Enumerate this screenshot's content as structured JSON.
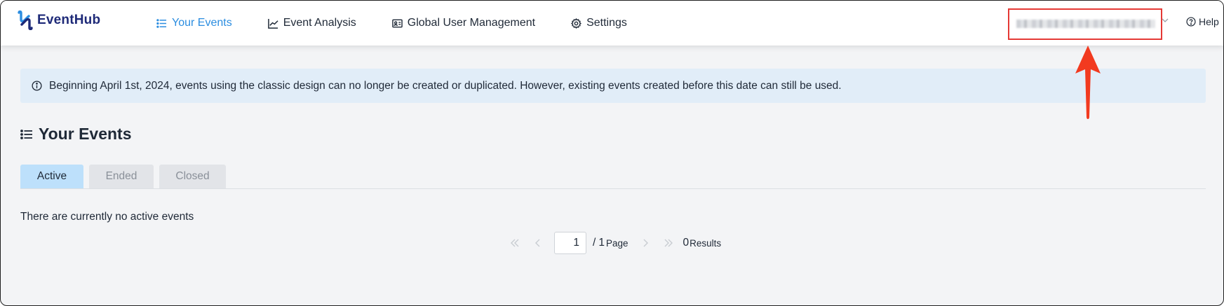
{
  "app": {
    "name": "EventHub",
    "brand_color": "#1e2a78",
    "accent_color": "#2b8de0"
  },
  "nav": {
    "items": [
      {
        "label": "Your Events",
        "icon": "list-icon",
        "active": true
      },
      {
        "label": "Event Analysis",
        "icon": "chart-line-icon",
        "active": false
      },
      {
        "label": "Global User Management",
        "icon": "id-card-icon",
        "active": false
      },
      {
        "label": "Settings",
        "icon": "gear-icon",
        "active": false
      }
    ]
  },
  "account": {
    "name_blurred": true,
    "highlight_color": "#e53935"
  },
  "help": {
    "label": "Help"
  },
  "notice": {
    "icon": "info-icon",
    "text": "Beginning April 1st, 2024, events using the classic design can no longer be created or duplicated. However, existing events created before this date can still be used."
  },
  "page": {
    "title": "Your Events",
    "title_icon": "list-icon"
  },
  "tabs": [
    {
      "label": "Active",
      "selected": true
    },
    {
      "label": "Ended",
      "selected": false
    },
    {
      "label": "Closed",
      "selected": false
    }
  ],
  "empty_message": "There are currently no active events",
  "pagination": {
    "current_page": "1",
    "separator": "/",
    "total_pages": "1",
    "page_unit": "Page",
    "result_count": "0",
    "results_label": "Results"
  }
}
